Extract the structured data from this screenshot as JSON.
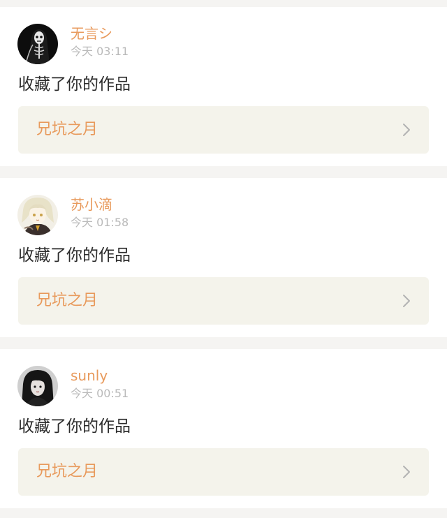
{
  "notifications": [
    {
      "username": "无言シ",
      "time": "今天 03:11",
      "action": "收藏了你的作品",
      "work_title": "兄坑之月",
      "avatar_icon": "skeleton-avatar-icon"
    },
    {
      "username": "苏小滴",
      "time": "今天 01:58",
      "action": "收藏了你的作品",
      "work_title": "兄坑之月",
      "avatar_icon": "anime-girl-avatar-icon"
    },
    {
      "username": "sunly",
      "time": "今天 00:51",
      "action": "收藏了你的作品",
      "work_title": "兄坑之月",
      "avatar_icon": "dark-hair-avatar-icon"
    }
  ],
  "colors": {
    "accent": "#e89a5c",
    "muted": "#b9b9b9",
    "text": "#2b2b2b",
    "link_bg": "#f4f3eb",
    "page_bg": "#f5f4f2"
  }
}
